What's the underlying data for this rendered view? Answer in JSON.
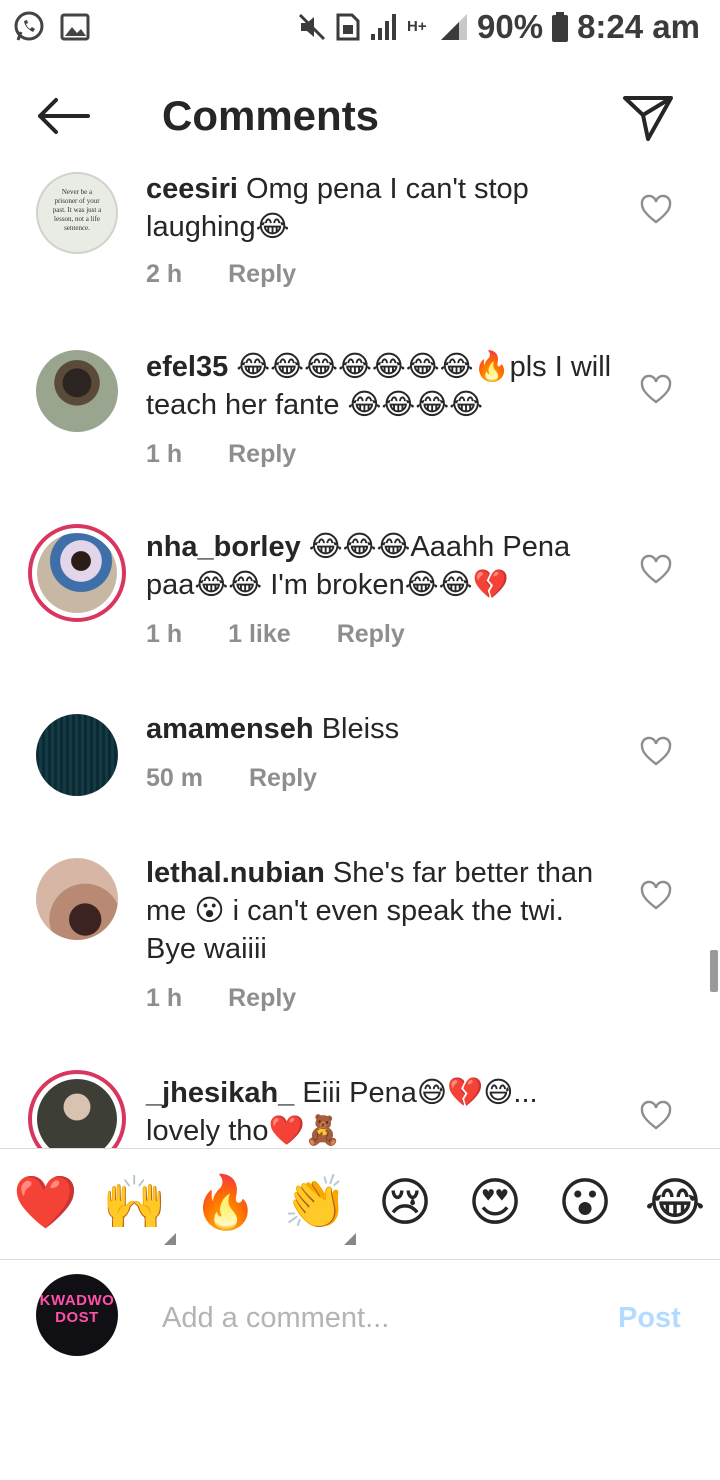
{
  "status_bar": {
    "battery": "90%",
    "time": "8:24 am",
    "network_label": "H+",
    "icons": [
      "whatsapp-icon",
      "gallery-icon",
      "mute-icon",
      "sim-icon",
      "signal-icon",
      "battery-icon"
    ]
  },
  "header": {
    "title": "Comments",
    "back_icon": "arrow-left-icon",
    "share_icon": "paper-plane-icon"
  },
  "comments": [
    {
      "username": "ceesiri",
      "text": "Omg pena I can't stop laughing😂",
      "time": "2 h",
      "likes": "",
      "reply": "Reply",
      "avatar_text": "Never be a prisoner of your past. It was just a lesson, not a life sentence."
    },
    {
      "username": "efel35",
      "text": "😂😂😂😂😂😂😂🔥pls I will teach her fante 😂😂😂😂",
      "time": "1 h",
      "likes": "",
      "reply": "Reply"
    },
    {
      "username": "nha_borley",
      "text": "😂😂😂Aaahh Pena paa😂😂 I'm broken😂😂💔",
      "time": "1 h",
      "likes": "1 like",
      "reply": "Reply"
    },
    {
      "username": "amamenseh",
      "text": "Bleiss",
      "time": "50 m",
      "likes": "",
      "reply": "Reply"
    },
    {
      "username": "lethal.nubian",
      "text": "She's far better than me 😮 i can't even speak the twi. Bye waiiii",
      "time": "1 h",
      "likes": "",
      "reply": "Reply"
    },
    {
      "username": "_jhesikah_",
      "text": "Eiii Pena😅💔😅... lovely tho❤️🧸",
      "time": "",
      "likes": "",
      "reply": ""
    }
  ],
  "emoji_bar": [
    "❤️",
    "🙌",
    "🔥",
    "👏",
    "😢",
    "😍",
    "😮",
    "😂"
  ],
  "composer": {
    "avatar_text": "KWADWO DOST",
    "placeholder": "Add a comment...",
    "post_label": "Post"
  },
  "colors": {
    "story_ring": "#d8365f",
    "post_disabled": "#b3dbff",
    "meta_grey": "#8e8e8e",
    "heart_red": "#ed4956"
  }
}
